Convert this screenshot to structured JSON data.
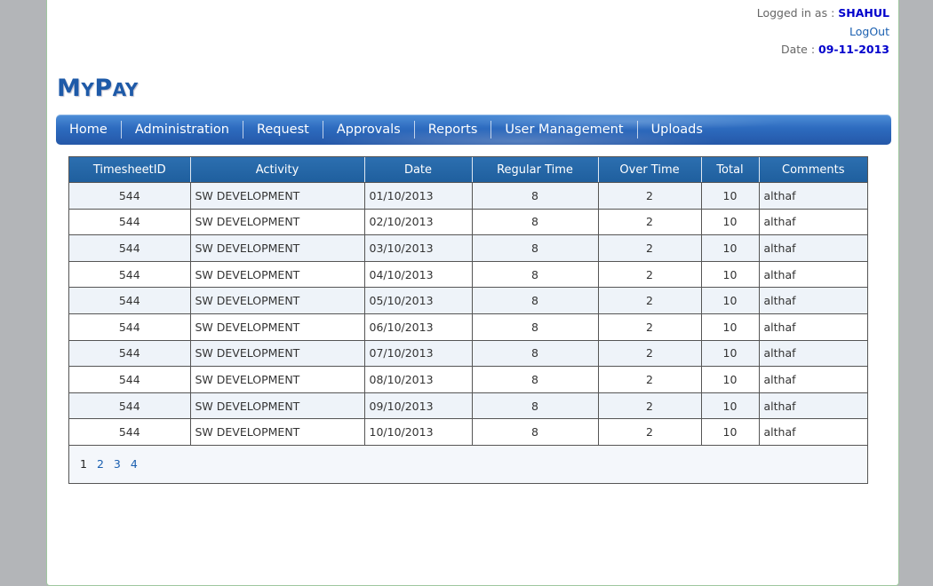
{
  "header": {
    "logged_in_label": "Logged in as :",
    "username": "SHAHUL",
    "logout_label": "LogOut",
    "date_label": "Date :",
    "date_value": "09-11-2013"
  },
  "logo": {
    "first_big": "M",
    "first_rest": "Y",
    "second_big": "P",
    "second_rest": "AY"
  },
  "nav": {
    "items": [
      "Home",
      "Administration",
      "Request",
      "Approvals",
      "Reports",
      "User Management",
      "Uploads"
    ]
  },
  "grid": {
    "columns": [
      "TimesheetID",
      "Activity",
      "Date",
      "Regular Time",
      "Over Time",
      "Total",
      "Comments"
    ],
    "rows": [
      {
        "id": "544",
        "activity": "SW DEVELOPMENT",
        "date": "01/10/2013",
        "regular": "8",
        "overtime": "2",
        "total": "10",
        "comments": "althaf"
      },
      {
        "id": "544",
        "activity": "SW DEVELOPMENT",
        "date": "02/10/2013",
        "regular": "8",
        "overtime": "2",
        "total": "10",
        "comments": "althaf"
      },
      {
        "id": "544",
        "activity": "SW DEVELOPMENT",
        "date": "03/10/2013",
        "regular": "8",
        "overtime": "2",
        "total": "10",
        "comments": "althaf"
      },
      {
        "id": "544",
        "activity": "SW DEVELOPMENT",
        "date": "04/10/2013",
        "regular": "8",
        "overtime": "2",
        "total": "10",
        "comments": "althaf"
      },
      {
        "id": "544",
        "activity": "SW DEVELOPMENT",
        "date": "05/10/2013",
        "regular": "8",
        "overtime": "2",
        "total": "10",
        "comments": "althaf"
      },
      {
        "id": "544",
        "activity": "SW DEVELOPMENT",
        "date": "06/10/2013",
        "regular": "8",
        "overtime": "2",
        "total": "10",
        "comments": "althaf"
      },
      {
        "id": "544",
        "activity": "SW DEVELOPMENT",
        "date": "07/10/2013",
        "regular": "8",
        "overtime": "2",
        "total": "10",
        "comments": "althaf"
      },
      {
        "id": "544",
        "activity": "SW DEVELOPMENT",
        "date": "08/10/2013",
        "regular": "8",
        "overtime": "2",
        "total": "10",
        "comments": "althaf"
      },
      {
        "id": "544",
        "activity": "SW DEVELOPMENT",
        "date": "09/10/2013",
        "regular": "8",
        "overtime": "2",
        "total": "10",
        "comments": "althaf"
      },
      {
        "id": "544",
        "activity": "SW DEVELOPMENT",
        "date": "10/10/2013",
        "regular": "8",
        "overtime": "2",
        "total": "10",
        "comments": "althaf"
      }
    ]
  },
  "pager": {
    "pages": [
      "1",
      "2",
      "3",
      "4"
    ],
    "current": "1"
  }
}
